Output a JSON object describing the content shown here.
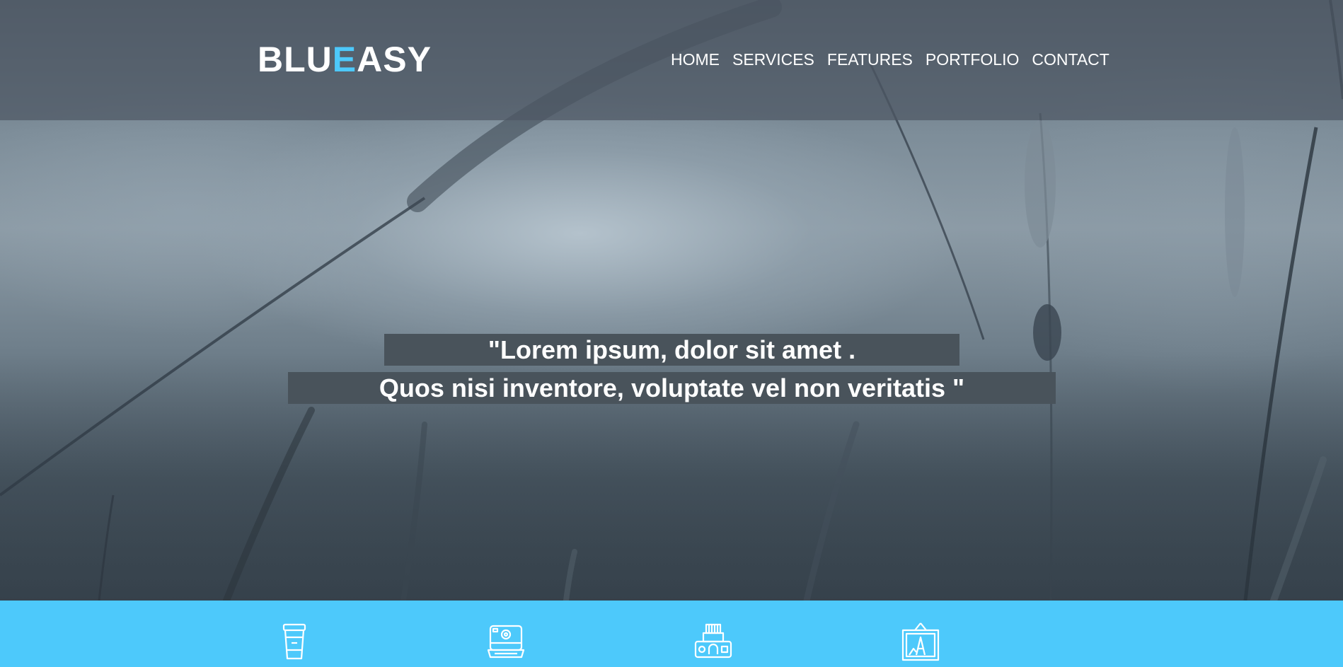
{
  "brand": {
    "logo_part1": "BLU",
    "logo_accent": "E",
    "logo_part2": "ASY",
    "accent_color": "#4dc9fb"
  },
  "nav": {
    "items": [
      "HOME",
      "SERVICES",
      "FEATURES",
      "PORTFOLIO",
      "CONTACT"
    ]
  },
  "hero": {
    "quote_line1": "\"Lorem ipsum, dolor sit amet .",
    "quote_line2": "Quos nisi inventore, voluptate vel non veritatis \""
  },
  "services": {
    "background_color": "#4dc9fb",
    "icons": [
      "coffee-cup-icon",
      "instant-camera-icon",
      "slr-camera-icon",
      "framed-picture-icon"
    ]
  }
}
